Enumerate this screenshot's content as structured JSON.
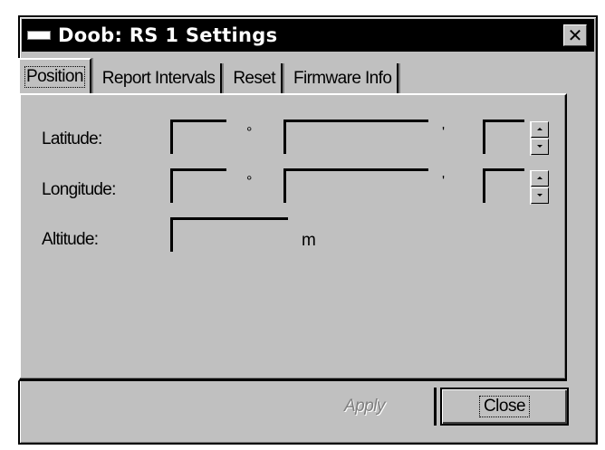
{
  "window": {
    "title": "Doob: RS 1 Settings",
    "close_glyph": "✕"
  },
  "tabs": [
    {
      "label": "Position",
      "active": true
    },
    {
      "label": "Report Intervals",
      "active": false
    },
    {
      "label": "Reset",
      "active": false
    },
    {
      "label": "Firmware Info",
      "active": false
    }
  ],
  "position": {
    "latitude": {
      "label": "Latitude:",
      "degrees": "",
      "degrees_unit": "°",
      "minutes": "",
      "minutes_unit": "'",
      "seconds": ""
    },
    "longitude": {
      "label": "Longitude:",
      "degrees": "",
      "degrees_unit": "°",
      "minutes": "",
      "minutes_unit": "'",
      "seconds": ""
    },
    "altitude": {
      "label": "Altitude:",
      "value": "",
      "unit": "m"
    }
  },
  "buttons": {
    "apply": "Apply",
    "close": "Close"
  },
  "colors": {
    "face": "#c0c0c0",
    "titlebar": "#000000",
    "disabled_text": "#808080"
  }
}
